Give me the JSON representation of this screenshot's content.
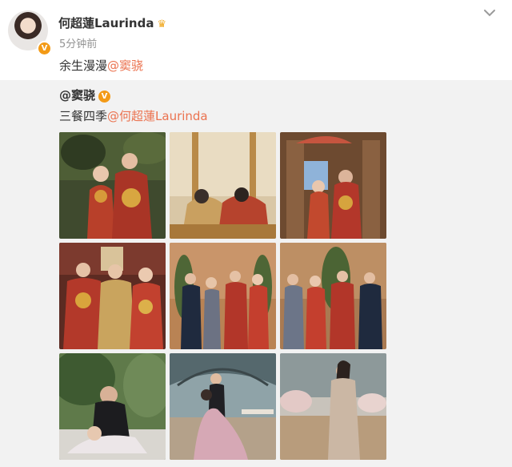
{
  "post": {
    "author": "何超蓮Laurinda",
    "time": "5分钟前",
    "text_prefix": "余生漫漫",
    "mention": "@窦骁"
  },
  "repost": {
    "author": "@窦骁",
    "text_prefix": "三餐四季",
    "mention": "@何超蓮Laurinda"
  },
  "photos": [
    "wedding-photo-1",
    "wedding-photo-2",
    "wedding-photo-3",
    "wedding-photo-4",
    "wedding-photo-5",
    "wedding-photo-6",
    "wedding-photo-7",
    "wedding-photo-8",
    "wedding-photo-9"
  ],
  "colors": {
    "mention": "#eb7350",
    "verified": "#f39a16",
    "repost_bg": "#f2f2f2"
  }
}
